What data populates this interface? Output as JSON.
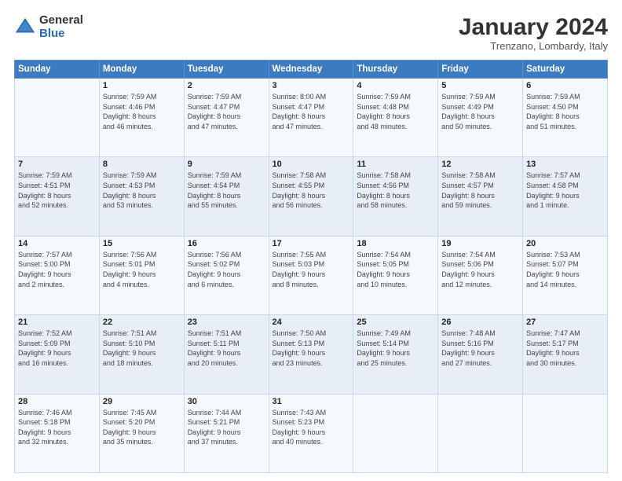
{
  "logo": {
    "general": "General",
    "blue": "Blue"
  },
  "title": "January 2024",
  "location": "Trenzano, Lombardy, Italy",
  "header_days": [
    "Sunday",
    "Monday",
    "Tuesday",
    "Wednesday",
    "Thursday",
    "Friday",
    "Saturday"
  ],
  "weeks": [
    [
      {
        "day": "",
        "info": ""
      },
      {
        "day": "1",
        "info": "Sunrise: 7:59 AM\nSunset: 4:46 PM\nDaylight: 8 hours\nand 46 minutes."
      },
      {
        "day": "2",
        "info": "Sunrise: 7:59 AM\nSunset: 4:47 PM\nDaylight: 8 hours\nand 47 minutes."
      },
      {
        "day": "3",
        "info": "Sunrise: 8:00 AM\nSunset: 4:47 PM\nDaylight: 8 hours\nand 47 minutes."
      },
      {
        "day": "4",
        "info": "Sunrise: 7:59 AM\nSunset: 4:48 PM\nDaylight: 8 hours\nand 48 minutes."
      },
      {
        "day": "5",
        "info": "Sunrise: 7:59 AM\nSunset: 4:49 PM\nDaylight: 8 hours\nand 50 minutes."
      },
      {
        "day": "6",
        "info": "Sunrise: 7:59 AM\nSunset: 4:50 PM\nDaylight: 8 hours\nand 51 minutes."
      }
    ],
    [
      {
        "day": "7",
        "info": "Sunrise: 7:59 AM\nSunset: 4:51 PM\nDaylight: 8 hours\nand 52 minutes."
      },
      {
        "day": "8",
        "info": "Sunrise: 7:59 AM\nSunset: 4:53 PM\nDaylight: 8 hours\nand 53 minutes."
      },
      {
        "day": "9",
        "info": "Sunrise: 7:59 AM\nSunset: 4:54 PM\nDaylight: 8 hours\nand 55 minutes."
      },
      {
        "day": "10",
        "info": "Sunrise: 7:58 AM\nSunset: 4:55 PM\nDaylight: 8 hours\nand 56 minutes."
      },
      {
        "day": "11",
        "info": "Sunrise: 7:58 AM\nSunset: 4:56 PM\nDaylight: 8 hours\nand 58 minutes."
      },
      {
        "day": "12",
        "info": "Sunrise: 7:58 AM\nSunset: 4:57 PM\nDaylight: 8 hours\nand 59 minutes."
      },
      {
        "day": "13",
        "info": "Sunrise: 7:57 AM\nSunset: 4:58 PM\nDaylight: 9 hours\nand 1 minute."
      }
    ],
    [
      {
        "day": "14",
        "info": "Sunrise: 7:57 AM\nSunset: 5:00 PM\nDaylight: 9 hours\nand 2 minutes."
      },
      {
        "day": "15",
        "info": "Sunrise: 7:56 AM\nSunset: 5:01 PM\nDaylight: 9 hours\nand 4 minutes."
      },
      {
        "day": "16",
        "info": "Sunrise: 7:56 AM\nSunset: 5:02 PM\nDaylight: 9 hours\nand 6 minutes."
      },
      {
        "day": "17",
        "info": "Sunrise: 7:55 AM\nSunset: 5:03 PM\nDaylight: 9 hours\nand 8 minutes."
      },
      {
        "day": "18",
        "info": "Sunrise: 7:54 AM\nSunset: 5:05 PM\nDaylight: 9 hours\nand 10 minutes."
      },
      {
        "day": "19",
        "info": "Sunrise: 7:54 AM\nSunset: 5:06 PM\nDaylight: 9 hours\nand 12 minutes."
      },
      {
        "day": "20",
        "info": "Sunrise: 7:53 AM\nSunset: 5:07 PM\nDaylight: 9 hours\nand 14 minutes."
      }
    ],
    [
      {
        "day": "21",
        "info": "Sunrise: 7:52 AM\nSunset: 5:09 PM\nDaylight: 9 hours\nand 16 minutes."
      },
      {
        "day": "22",
        "info": "Sunrise: 7:51 AM\nSunset: 5:10 PM\nDaylight: 9 hours\nand 18 minutes."
      },
      {
        "day": "23",
        "info": "Sunrise: 7:51 AM\nSunset: 5:11 PM\nDaylight: 9 hours\nand 20 minutes."
      },
      {
        "day": "24",
        "info": "Sunrise: 7:50 AM\nSunset: 5:13 PM\nDaylight: 9 hours\nand 23 minutes."
      },
      {
        "day": "25",
        "info": "Sunrise: 7:49 AM\nSunset: 5:14 PM\nDaylight: 9 hours\nand 25 minutes."
      },
      {
        "day": "26",
        "info": "Sunrise: 7:48 AM\nSunset: 5:16 PM\nDaylight: 9 hours\nand 27 minutes."
      },
      {
        "day": "27",
        "info": "Sunrise: 7:47 AM\nSunset: 5:17 PM\nDaylight: 9 hours\nand 30 minutes."
      }
    ],
    [
      {
        "day": "28",
        "info": "Sunrise: 7:46 AM\nSunset: 5:18 PM\nDaylight: 9 hours\nand 32 minutes."
      },
      {
        "day": "29",
        "info": "Sunrise: 7:45 AM\nSunset: 5:20 PM\nDaylight: 9 hours\nand 35 minutes."
      },
      {
        "day": "30",
        "info": "Sunrise: 7:44 AM\nSunset: 5:21 PM\nDaylight: 9 hours\nand 37 minutes."
      },
      {
        "day": "31",
        "info": "Sunrise: 7:43 AM\nSunset: 5:23 PM\nDaylight: 9 hours\nand 40 minutes."
      },
      {
        "day": "",
        "info": ""
      },
      {
        "day": "",
        "info": ""
      },
      {
        "day": "",
        "info": ""
      }
    ]
  ]
}
